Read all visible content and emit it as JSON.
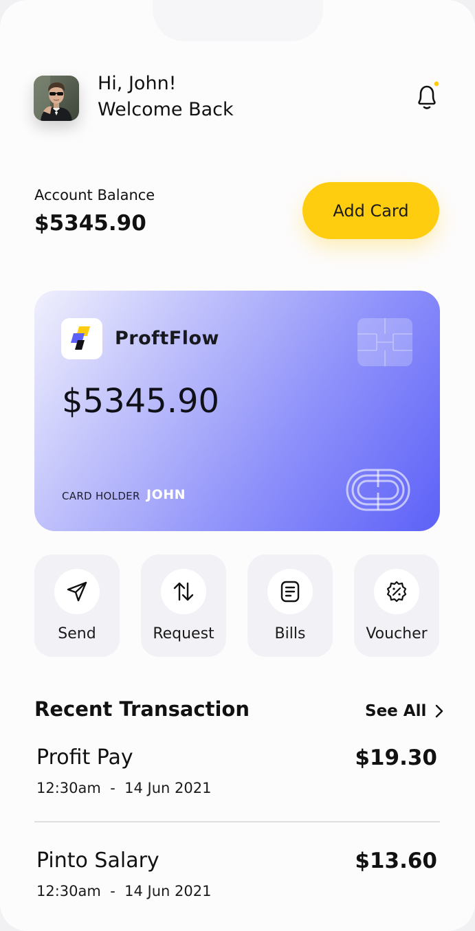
{
  "header": {
    "greeting": "Hi, John!",
    "subtitle": "Welcome Back",
    "avatar_icon": "user-avatar",
    "notification_icon": "bell-icon",
    "notification_dot_color": "#ffcd0f"
  },
  "balance": {
    "label": "Account Balance",
    "amount": "$5345.90",
    "add_card_label": "Add Card"
  },
  "card": {
    "brand": "ProftFlow",
    "amount": "$5345.90",
    "holder_label": "CARD HOLDER",
    "holder_name": "JOHN",
    "gradient_start": "#f0f0fd",
    "gradient_end": "#5d61f7"
  },
  "actions": [
    {
      "label": "Send",
      "icon": "send-icon"
    },
    {
      "label": "Request",
      "icon": "arrows-up-down-icon"
    },
    {
      "label": "Bills",
      "icon": "bill-icon"
    },
    {
      "label": "Voucher",
      "icon": "voucher-icon"
    }
  ],
  "transactions": {
    "title": "Recent Transaction",
    "see_all_label": "See All",
    "items": [
      {
        "name": "Profit Pay",
        "amount": "$19.30",
        "time": "12:30am  -  14 Jun 2021"
      },
      {
        "name": "Pinto Salary",
        "amount": "$13.60",
        "time": "12:30am  -  14 Jun 2021"
      }
    ]
  },
  "colors": {
    "accent": "#ffcd0f",
    "card_purple": "#5d61f7",
    "action_bg": "#f2f1f6"
  }
}
